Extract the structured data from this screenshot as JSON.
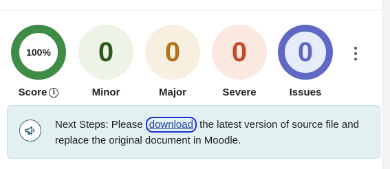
{
  "metrics": {
    "score": {
      "value": "100%",
      "label": "Score",
      "info_icon": "info-icon"
    },
    "minor": {
      "value": "0",
      "label": "Minor"
    },
    "major": {
      "value": "0",
      "label": "Major"
    },
    "severe": {
      "value": "0",
      "label": "Severe"
    },
    "issues": {
      "value": "0",
      "label": "Issues"
    }
  },
  "menu": {
    "icon": "kebab-menu-icon"
  },
  "next_steps": {
    "icon": "megaphone-icon",
    "prefix": "Next Steps: Please ",
    "link_text": "download",
    "suffix": " the latest version of source file and replace the original document in Moodle."
  },
  "colors": {
    "score_ring": "#3e8c46",
    "minor": "#2f5a1c",
    "major": "#b5711a",
    "severe": "#c24a26",
    "issues": "#5f68c4",
    "notice_bg": "#e3f0f2"
  }
}
